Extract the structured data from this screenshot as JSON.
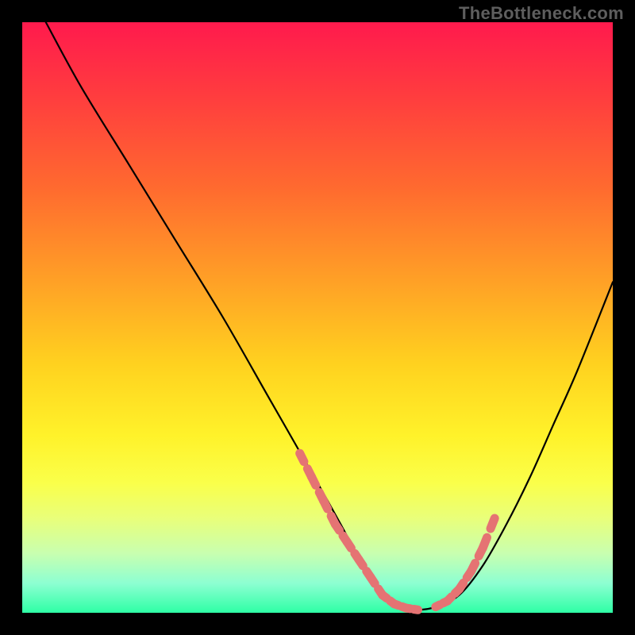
{
  "watermark": "TheBottleneck.com",
  "chart_data": {
    "type": "line",
    "title": "",
    "xlabel": "",
    "ylabel": "",
    "xlim": [
      0,
      100
    ],
    "ylim": [
      0,
      100
    ],
    "grid": false,
    "series": [
      {
        "name": "bottleneck-curve",
        "x": [
          4,
          10,
          18,
          26,
          34,
          42,
          50,
          55,
          58,
          61,
          64,
          67,
          70,
          74,
          78,
          82,
          86,
          90,
          94,
          100
        ],
        "y": [
          100,
          89,
          76,
          63,
          50,
          36,
          22,
          13,
          7,
          3,
          1,
          0.5,
          1,
          3,
          8,
          15,
          23,
          32,
          41,
          56
        ]
      },
      {
        "name": "highlight-range-left",
        "x": [
          47,
          49,
          51,
          53,
          55,
          57,
          59,
          61,
          63,
          65,
          67
        ],
        "y": [
          27,
          23,
          19,
          15,
          12,
          9,
          6,
          3,
          1.5,
          0.8,
          0.5
        ]
      },
      {
        "name": "highlight-range-right",
        "x": [
          70,
          72,
          74,
          76,
          78,
          80
        ],
        "y": [
          1,
          2,
          4,
          7,
          11,
          16
        ]
      }
    ],
    "annotations": []
  }
}
